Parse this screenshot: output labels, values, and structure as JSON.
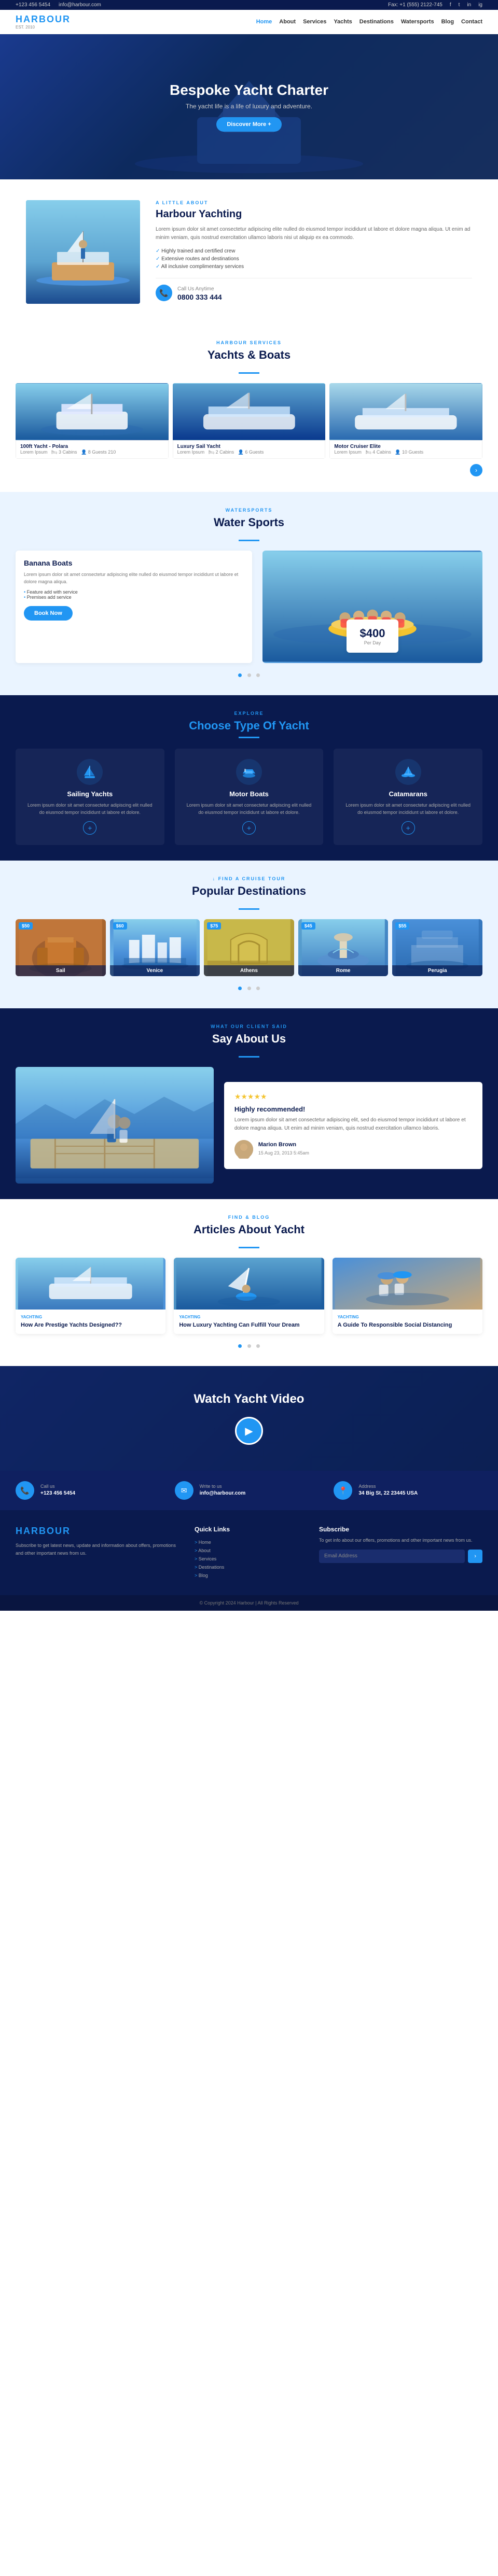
{
  "topbar": {
    "phone1": "+123 456 5454",
    "email": "info@harbour.com",
    "phone2": "Fax: +1 (555) 2122-745",
    "social": [
      "facebook",
      "twitter",
      "linkedin",
      "instagram"
    ]
  },
  "nav": {
    "logo": "HARBOUR",
    "links": [
      "Home",
      "About",
      "Services",
      "Yachts",
      "Destinations",
      "Watersports",
      "Blog",
      "Contact"
    ]
  },
  "hero": {
    "title": "Bespoke Yacht Charter",
    "subtitle": "The yacht life is a life of luxury and adventure.",
    "cta": "Discover More +"
  },
  "about": {
    "tag": "A LITTLE ABOUT",
    "heading": "Harbour Yachting",
    "description": "Lorem ipsum dolor sit amet consectetur adipiscing elite nulled do eiusmod tempor incididunt ut labore et dolore magna aliqua. Ut enim ad minim veniam, quis nostrud exercitation ullamco laboris nisi ut aliquip ex ea commodo.",
    "features": [
      "Highly trained and certified crew",
      "Extensive routes and destinations",
      "All inclusive complimentary services"
    ],
    "contact_label": "Call Us Anytime",
    "phone": "0800 333 444"
  },
  "yachts": {
    "tag": "HARBOUR SERVICES",
    "heading": "Yachts & Boats",
    "items": [
      {
        "title": "100ft Yacht - Polara",
        "author": "Lorem Ipsum",
        "cabins": "3 Cabins",
        "guests": "8 Guests 210"
      },
      {
        "title": "Luxury Sail Yacht",
        "author": "Lorem Ipsum",
        "cabins": "2 Cabins",
        "guests": "6 Guests"
      },
      {
        "title": "Motor Cruiser Elite",
        "author": "Lorem Ipsum",
        "cabins": "4 Cabins",
        "guests": "10 Guests"
      }
    ]
  },
  "water_sports": {
    "tag": "WATERSPORTS",
    "heading": "Water Sports",
    "card": {
      "title": "Banana Boats",
      "description": "Lorem ipsum dolor sit amet consectetur adipiscing elite nulled do eiusmod tempor incididunt ut labore et dolore magna aliqua.",
      "features": [
        "Feature add with service",
        "Premises add service"
      ],
      "cta": "Book Now"
    },
    "price": "$400",
    "price_label": "Per Day"
  },
  "choose": {
    "tag": "EXPLORE",
    "heading_pre": "Choose",
    "heading_post": "Type Of Yacht",
    "items": [
      {
        "icon": "⛵",
        "title": "Sailing Yachts",
        "description": "Lorem ipsum dolor sit amet consectetur adipiscing elit nulled do eiusmod tempor incididunt ut labore et dolore."
      },
      {
        "icon": "🚤",
        "title": "Motor Boats",
        "description": "Lorem ipsum dolor sit amet consectetur adipiscing elit nulled do eiusmod tempor incididunt ut labore et dolore."
      },
      {
        "icon": "⛵",
        "title": "Catamarans",
        "description": "Lorem ipsum dolor sit amet consectetur adipiscing elit nulled do eiusmod tempor incididunt ut labore et dolore."
      }
    ]
  },
  "destinations": {
    "tag": "↓ FIND A CRUISE TOUR",
    "heading": "Popular Destinations",
    "items": [
      {
        "name": "Sail",
        "price": "$50"
      },
      {
        "name": "Venice",
        "price": "$60"
      },
      {
        "name": "Athens",
        "price": "$75"
      },
      {
        "name": "Rome",
        "price": "$45"
      },
      {
        "name": "Perugia",
        "price": "$55"
      }
    ]
  },
  "testimonials": {
    "tag": "WHAT OUR CLIENT SAID",
    "heading": "Say About Us",
    "review": {
      "rating": "★★★★★",
      "title": "Highly recommended!",
      "text": "Lorem ipsum dolor sit amet consectetur adipiscing elit, sed do eiusmod tempor incididunt ut labore et dolore magna aliqua. Ut enim ad minim veniam, quis nostrud exercitation ullamco laboris.",
      "author": "Marion Brown",
      "date": "15 Aug 23, 2013 5:45am"
    }
  },
  "articles": {
    "tag": "FIND & BLOG",
    "heading": "Articles About Yacht",
    "items": [
      {
        "tag": "YACHTING",
        "title": "How Are Prestige Yachts Designed??"
      },
      {
        "tag": "YACHTING",
        "title": "How Luxury Yachting Can Fulfill Your Dream"
      },
      {
        "tag": "YACHTING",
        "title": "A Guide To Responsible Social Distancing"
      }
    ]
  },
  "video": {
    "heading": "Watch Yacht Video"
  },
  "footer_contact": {
    "items": [
      {
        "icon": "📞",
        "label": "Call us",
        "value": "+123 456 5454"
      },
      {
        "icon": "✉",
        "label": "Write to us",
        "value": "info@harbour.com"
      },
      {
        "icon": "📍",
        "label": "Address",
        "value": "34 Big St, 22 23445 USA"
      }
    ]
  },
  "footer": {
    "logo": "HARBOUR",
    "about": "Subscribe to get latest news, update and information about offers, promotions and other important news from us.",
    "quick_links": {
      "heading": "Quick Links",
      "items": [
        "Home",
        "About",
        "Services",
        "Destinations",
        "Blog"
      ]
    },
    "subscribe": {
      "heading": "Subscribe",
      "text": "To get info about our offers, promotions and other important news from us.",
      "placeholder": "Email Address"
    },
    "copyright": "© Copyright 2024 Harbour | All Rights Reserved"
  }
}
